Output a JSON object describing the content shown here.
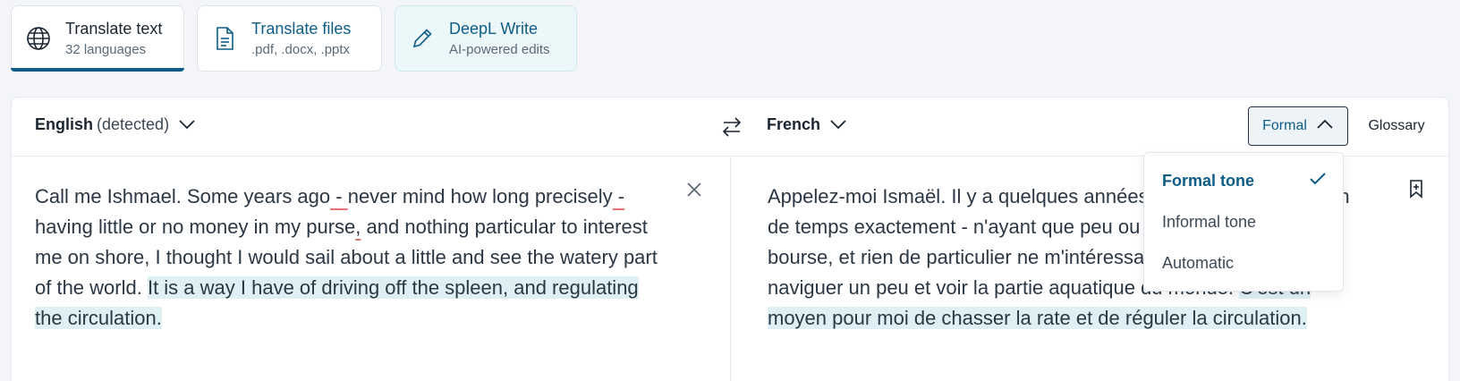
{
  "tabs": [
    {
      "title": "Translate text",
      "subtitle": "32 languages",
      "icon": "globe-icon",
      "active": true
    },
    {
      "title": "Translate files",
      "subtitle": ".pdf, .docx, .pptx",
      "icon": "document-icon",
      "active": false
    },
    {
      "title": "DeepL Write",
      "subtitle": "AI-powered edits",
      "icon": "pencil-icon",
      "active": false
    }
  ],
  "source": {
    "language": "English",
    "detected": "(detected)",
    "text_parts": {
      "p1": "Call me Ishmael. Some years ago",
      "p2": " - ",
      "p3": "never mind how long precisely",
      "p4": " -",
      "p5": " having little or no money in my purse",
      "p6": ",",
      "p7": " and nothing particular to interest me on shore, I thought I would sail about a little and see the watery part of the world. ",
      "highlight": "It is a way I have of driving off the spleen, and regulating the circulation."
    }
  },
  "target": {
    "language": "French",
    "text_plain": "Appelez-moi Ismaël. Il y a quelques années - peu importe combien de temps exactement - n'ayant que peu ou pas d'argent dans ma bourse, et rien de particulier ne m'intéressant à terre, j'ai pensé naviguer un peu et voir la partie aquatique du monde. ",
    "text_highlight": "C'est un moyen pour moi de chasser la rate et de réguler la circulation."
  },
  "toolbar": {
    "formal_label": "Formal",
    "glossary_label": "Glossary"
  },
  "tone_menu": {
    "items": [
      "Formal tone",
      "Informal tone",
      "Automatic"
    ],
    "selected": "Formal tone"
  },
  "colors": {
    "accent": "#0f5d86",
    "highlight": "#dff0f4"
  }
}
